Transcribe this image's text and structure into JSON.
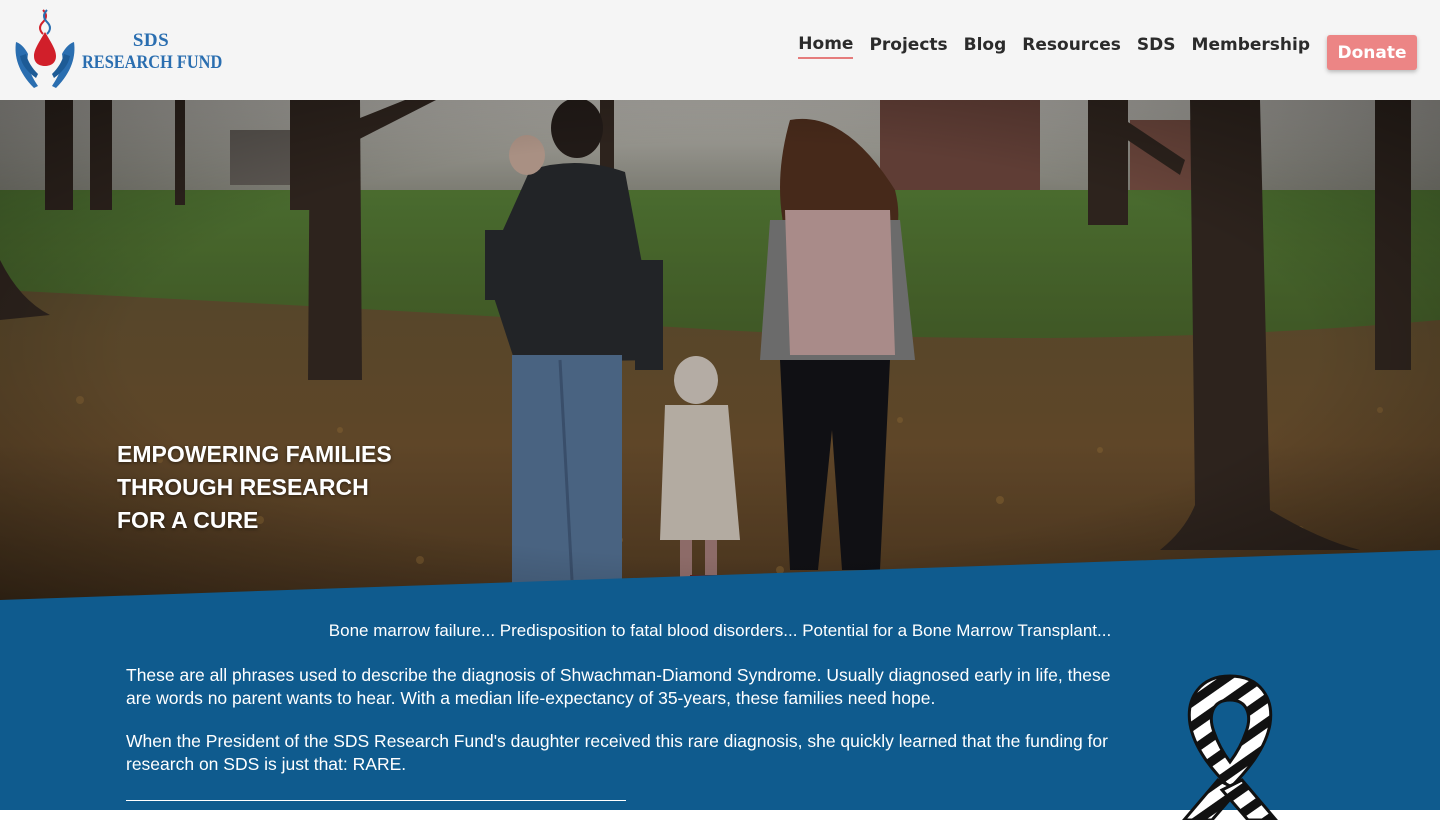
{
  "brand": {
    "logo_line1": "SDS",
    "logo_line2": "RESEARCH FUND",
    "primary_color": "#2a6eb0",
    "accent_color": "#ec8585",
    "drop_color": "#d11f2a"
  },
  "nav": {
    "items": [
      {
        "label": "Home",
        "active": true
      },
      {
        "label": "Projects"
      },
      {
        "label": "Blog"
      },
      {
        "label": "Resources"
      },
      {
        "label": "SDS"
      },
      {
        "label": "Membership"
      }
    ],
    "donate_label": "Donate"
  },
  "hero": {
    "tagline_line1": "EMPOWERING FAMILIES",
    "tagline_line2": "THROUGH RESEARCH",
    "tagline_line3": "FOR A CURE"
  },
  "intro": {
    "headline": "Bone marrow failure... Predisposition to fatal blood disorders... Potential for a Bone Marrow Transplant...",
    "paragraph1": "These are all phrases used to describe the diagnosis of Shwachman-Diamond Syndrome. Usually diagnosed early in life, these are words no parent wants to hear. With a median life-expectancy of 35-years, these families need hope.",
    "paragraph2": "When the President of the SDS Research Fund's daughter received this rare diagnosis, she quickly learned that the funding for research on SDS is just that: RARE.",
    "section_color": "#0f5b8e"
  }
}
